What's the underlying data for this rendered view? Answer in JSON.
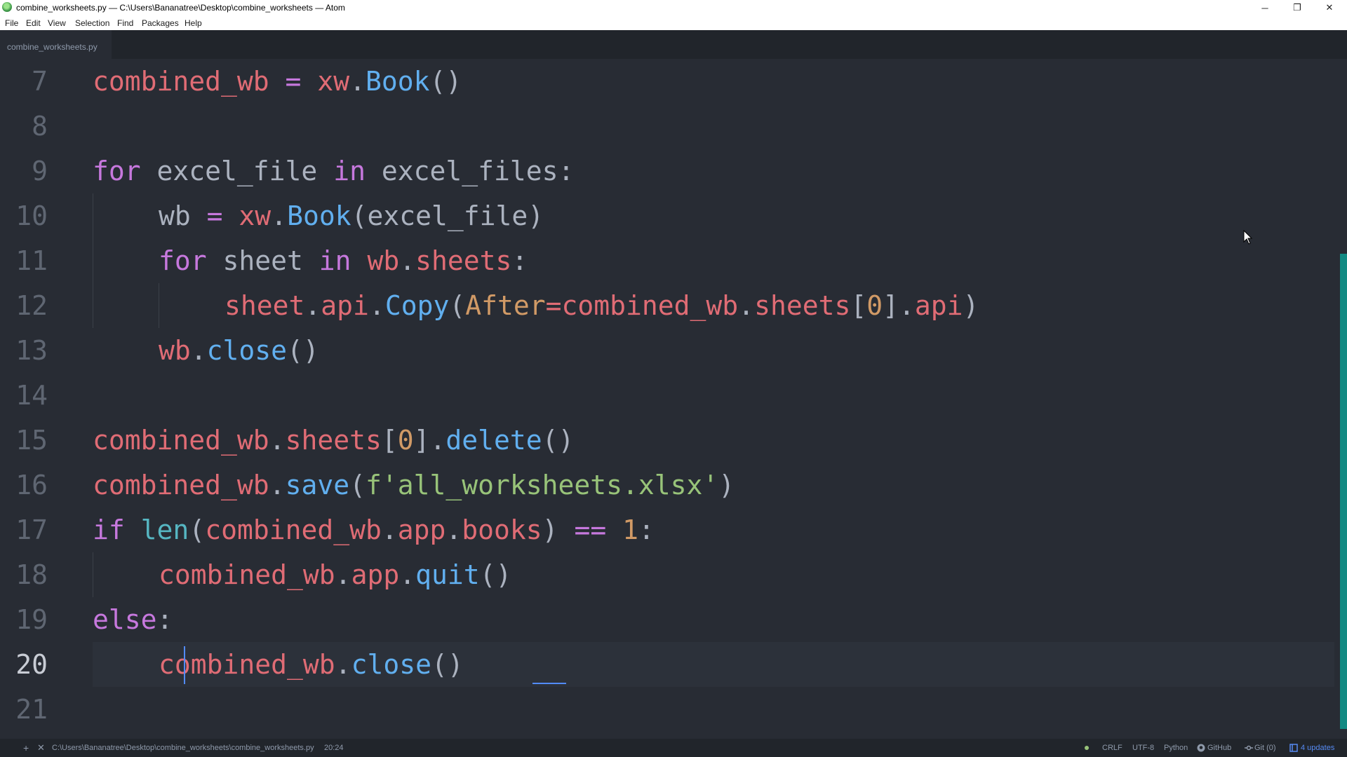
{
  "window": {
    "title": "combine_worksheets.py — C:\\Users\\Bananatree\\Desktop\\combine_worksheets — Atom",
    "minimize_glyph": "─",
    "restore_glyph": "❐",
    "close_glyph": "✕"
  },
  "menu": [
    "File",
    "Edit",
    "View",
    "Selection",
    "Find",
    "Packages",
    "Help"
  ],
  "tab": {
    "label": "combine_worksheets.py"
  },
  "editor": {
    "line_numbers": [
      "7",
      "8",
      "9",
      "10",
      "11",
      "12",
      "13",
      "14",
      "15",
      "16",
      "17",
      "18",
      "19",
      "20",
      "21"
    ],
    "current_line": "20",
    "code": {
      "l7": {
        "p1": "combined_wb",
        "p2": " = ",
        "p3": "xw",
        "p4": ".",
        "p5": "Book",
        "p6": "()"
      },
      "l9": {
        "p1": "for",
        "p2": " excel_file ",
        "p3": "in",
        "p4": " excel_files:"
      },
      "l10": {
        "p1": "wb",
        "p2": " = ",
        "p3": "xw",
        "p4": ".",
        "p5": "Book",
        "p6": "(excel_file)"
      },
      "l11": {
        "p1": "for",
        "p2": " sheet ",
        "p3": "in",
        "p4": " ",
        "p5": "wb",
        "p6": ".",
        "p7": "sheets",
        "p8": ":"
      },
      "l12": {
        "p1": "sheet",
        "p2": ".",
        "p3": "api",
        "p4": ".",
        "p5": "Copy",
        "p6": "(",
        "p7": "After",
        "p8": "=",
        "p9": "combined_wb",
        "p10": ".",
        "p11": "sheets",
        "p12": "[",
        "p13": "0",
        "p14": "].",
        "p15": "api",
        "p16": ")"
      },
      "l13": {
        "p1": "wb",
        "p2": ".",
        "p3": "close",
        "p4": "()"
      },
      "l15": {
        "p1": "combined_wb",
        "p2": ".",
        "p3": "sheets",
        "p4": "[",
        "p5": "0",
        "p6": "].",
        "p7": "delete",
        "p8": "()"
      },
      "l16": {
        "p1": "combined_wb",
        "p2": ".",
        "p3": "save",
        "p4": "(",
        "p5": "f'all_worksheets.xlsx'",
        "p6": ")"
      },
      "l17": {
        "p1": "if",
        "p2": " ",
        "p3": "len",
        "p4": "(",
        "p5": "combined_wb",
        "p6": ".",
        "p7": "app",
        "p8": ".",
        "p9": "books",
        "p10": ") ",
        "p11": "==",
        "p12": " ",
        "p13": "1",
        "p14": ":"
      },
      "l18": {
        "p1": "combined_wb",
        "p2": ".",
        "p3": "app",
        "p4": ".",
        "p5": "quit",
        "p6": "()"
      },
      "l19": {
        "p1": "else",
        "p2": ":"
      },
      "l20": {
        "p1": "combined_wb",
        "p2": ".",
        "p3": "close",
        "p4": "()"
      }
    }
  },
  "status": {
    "add_glyph": "+",
    "close_glyph": "✕",
    "file_path": "C:\\Users\\Bananatree\\Desktop\\combine_worksheets\\combine_worksheets.py",
    "cursor_position": "20:24",
    "line_ending": "CRLF",
    "encoding": "UTF-8",
    "grammar": "Python",
    "github": "GitHub",
    "git": "Git (0)",
    "updates": "4 updates"
  },
  "colors": {
    "editor_bg": "#282c34",
    "keyword": "#c678dd",
    "variable": "#e06c75",
    "function": "#61afef",
    "builtin": "#56b6c2",
    "number": "#d19a66",
    "string": "#98c379",
    "scrollbar": "#138a83",
    "accent": "#568af2"
  }
}
